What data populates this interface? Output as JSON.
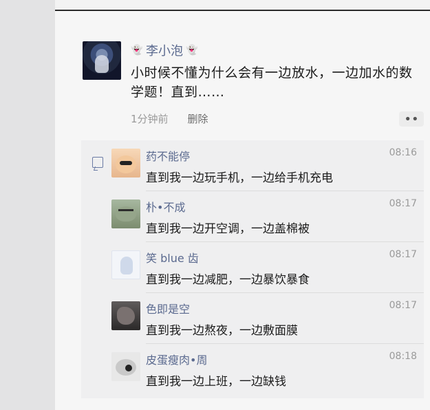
{
  "post": {
    "nickname": "李小泡",
    "text": "小时候不懂为什么会有一边放水，一边加水的数学题！直到……",
    "time": "1分钟前",
    "delete_label": "删除",
    "more_label": "••"
  },
  "comments": [
    {
      "name": "药不能停",
      "time": "08:16",
      "text": "直到我一边玩手机，一边给手机充电"
    },
    {
      "name": "朴•不成",
      "time": "08:17",
      "text": "直到我一边开空调，一边盖棉被"
    },
    {
      "name": "笑 blue 齿",
      "time": "08:17",
      "text": "直到我一边减肥，一边暴饮暴食"
    },
    {
      "name": "色即是空",
      "time": "08:17",
      "text": "直到我一边熬夜，一边敷面膜"
    },
    {
      "name": "皮蛋瘦肉•周",
      "time": "08:18",
      "text": "直到我一边上班，一边缺钱"
    }
  ],
  "icons": {
    "ghost": "ghost-icon",
    "comment": "comment-icon",
    "more": "more-icon"
  }
}
